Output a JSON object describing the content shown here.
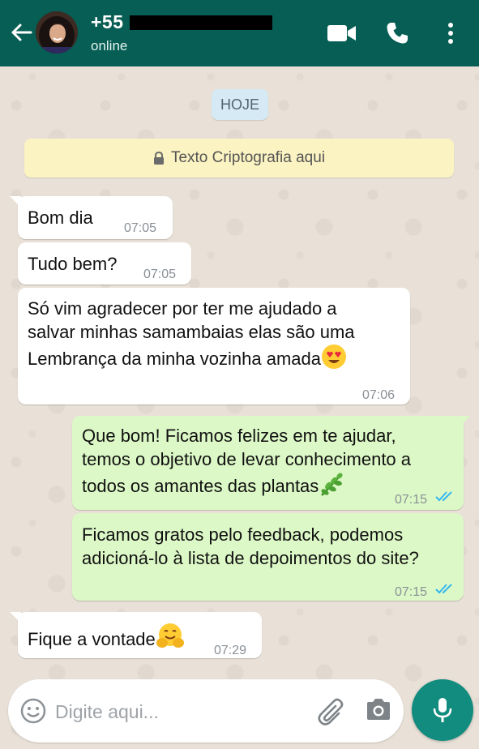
{
  "header": {
    "contact_name": "+55",
    "status": "online"
  },
  "chat": {
    "date_label": "HOJE",
    "encryption_notice": "Texto Criptografia aqui",
    "messages": [
      {
        "direction": "in",
        "text": "Bom dia",
        "time": "07:05"
      },
      {
        "direction": "in",
        "text": "Tudo bem?",
        "time": "07:05"
      },
      {
        "direction": "in",
        "lines": [
          "Só vim agradecer por ter me ajudado a",
          "salvar minhas samambaias elas são uma",
          "Lembrança da minha vozinha amada"
        ],
        "emoji": "heart-eyes-emoji",
        "time": "07:06"
      },
      {
        "direction": "out",
        "lines": [
          "Que bom! Ficamos felizes em te ajudar,",
          "temos o objetivo de levar conhecimento a",
          "todos os amantes das plantas"
        ],
        "emoji": "herb-emoji",
        "time": "07:15",
        "status": "read"
      },
      {
        "direction": "out",
        "lines": [
          "Ficamos gratos pelo feedback, podemos",
          "adicioná-lo à lista de depoimentos do site?"
        ],
        "time": "07:15",
        "status": "read"
      },
      {
        "direction": "in",
        "text": "Fique a vontade",
        "emoji": "hugging-emoji",
        "time": "07:29"
      }
    ]
  },
  "composer": {
    "placeholder": "Digite aqui..."
  },
  "colors": {
    "header": "#075e54",
    "incoming_bubble": "#ffffff",
    "outgoing_bubble": "#dcf8c6",
    "read_ticks": "#34b7f1",
    "mic_button": "#128c7e"
  }
}
